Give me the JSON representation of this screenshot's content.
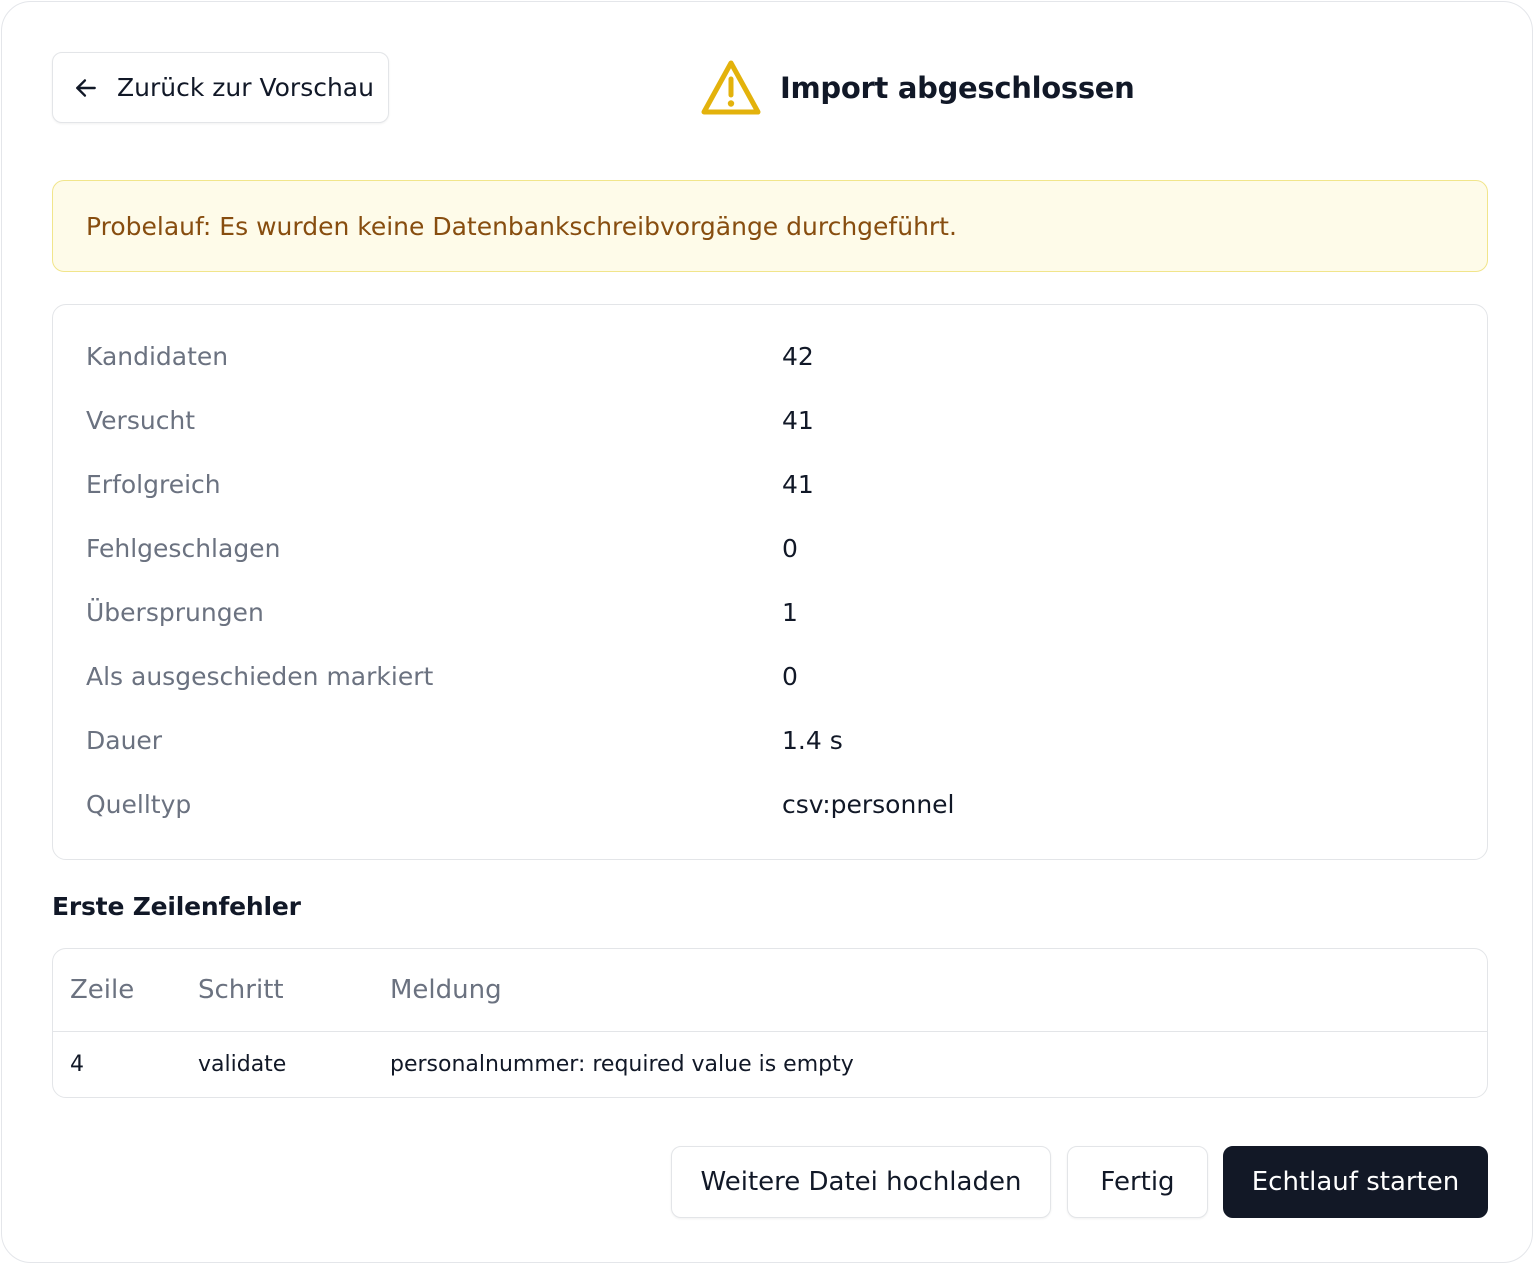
{
  "header": {
    "back_label": "Zurück zur Vorschau",
    "title": "Import abgeschlossen",
    "title_icon": "warning-triangle-icon",
    "back_icon": "arrow-left-icon",
    "warning_color": "#e3b20c"
  },
  "banner": {
    "text": "Probelauf: Es wurden keine Datenbankschreibvorgänge durchgeführt."
  },
  "stats": [
    {
      "label": "Kandidaten",
      "value": "42"
    },
    {
      "label": "Versucht",
      "value": "41"
    },
    {
      "label": "Erfolgreich",
      "value": "41"
    },
    {
      "label": "Fehlgeschlagen",
      "value": "0"
    },
    {
      "label": "Übersprungen",
      "value": "1"
    },
    {
      "label": "Als ausgeschieden markiert",
      "value": "0"
    },
    {
      "label": "Dauer",
      "value": "1.4 s"
    },
    {
      "label": "Quelltyp",
      "value": "csv:personnel"
    }
  ],
  "errors": {
    "title": "Erste Zeilenfehler",
    "columns": [
      "Zeile",
      "Schritt",
      "Meldung"
    ],
    "rows": [
      [
        "4",
        "validate",
        "personalnummer: required value is empty"
      ]
    ]
  },
  "actions": {
    "upload_label": "Weitere Datei hochladen",
    "done_label": "Fertig",
    "run_label": "Echtlauf starten"
  }
}
